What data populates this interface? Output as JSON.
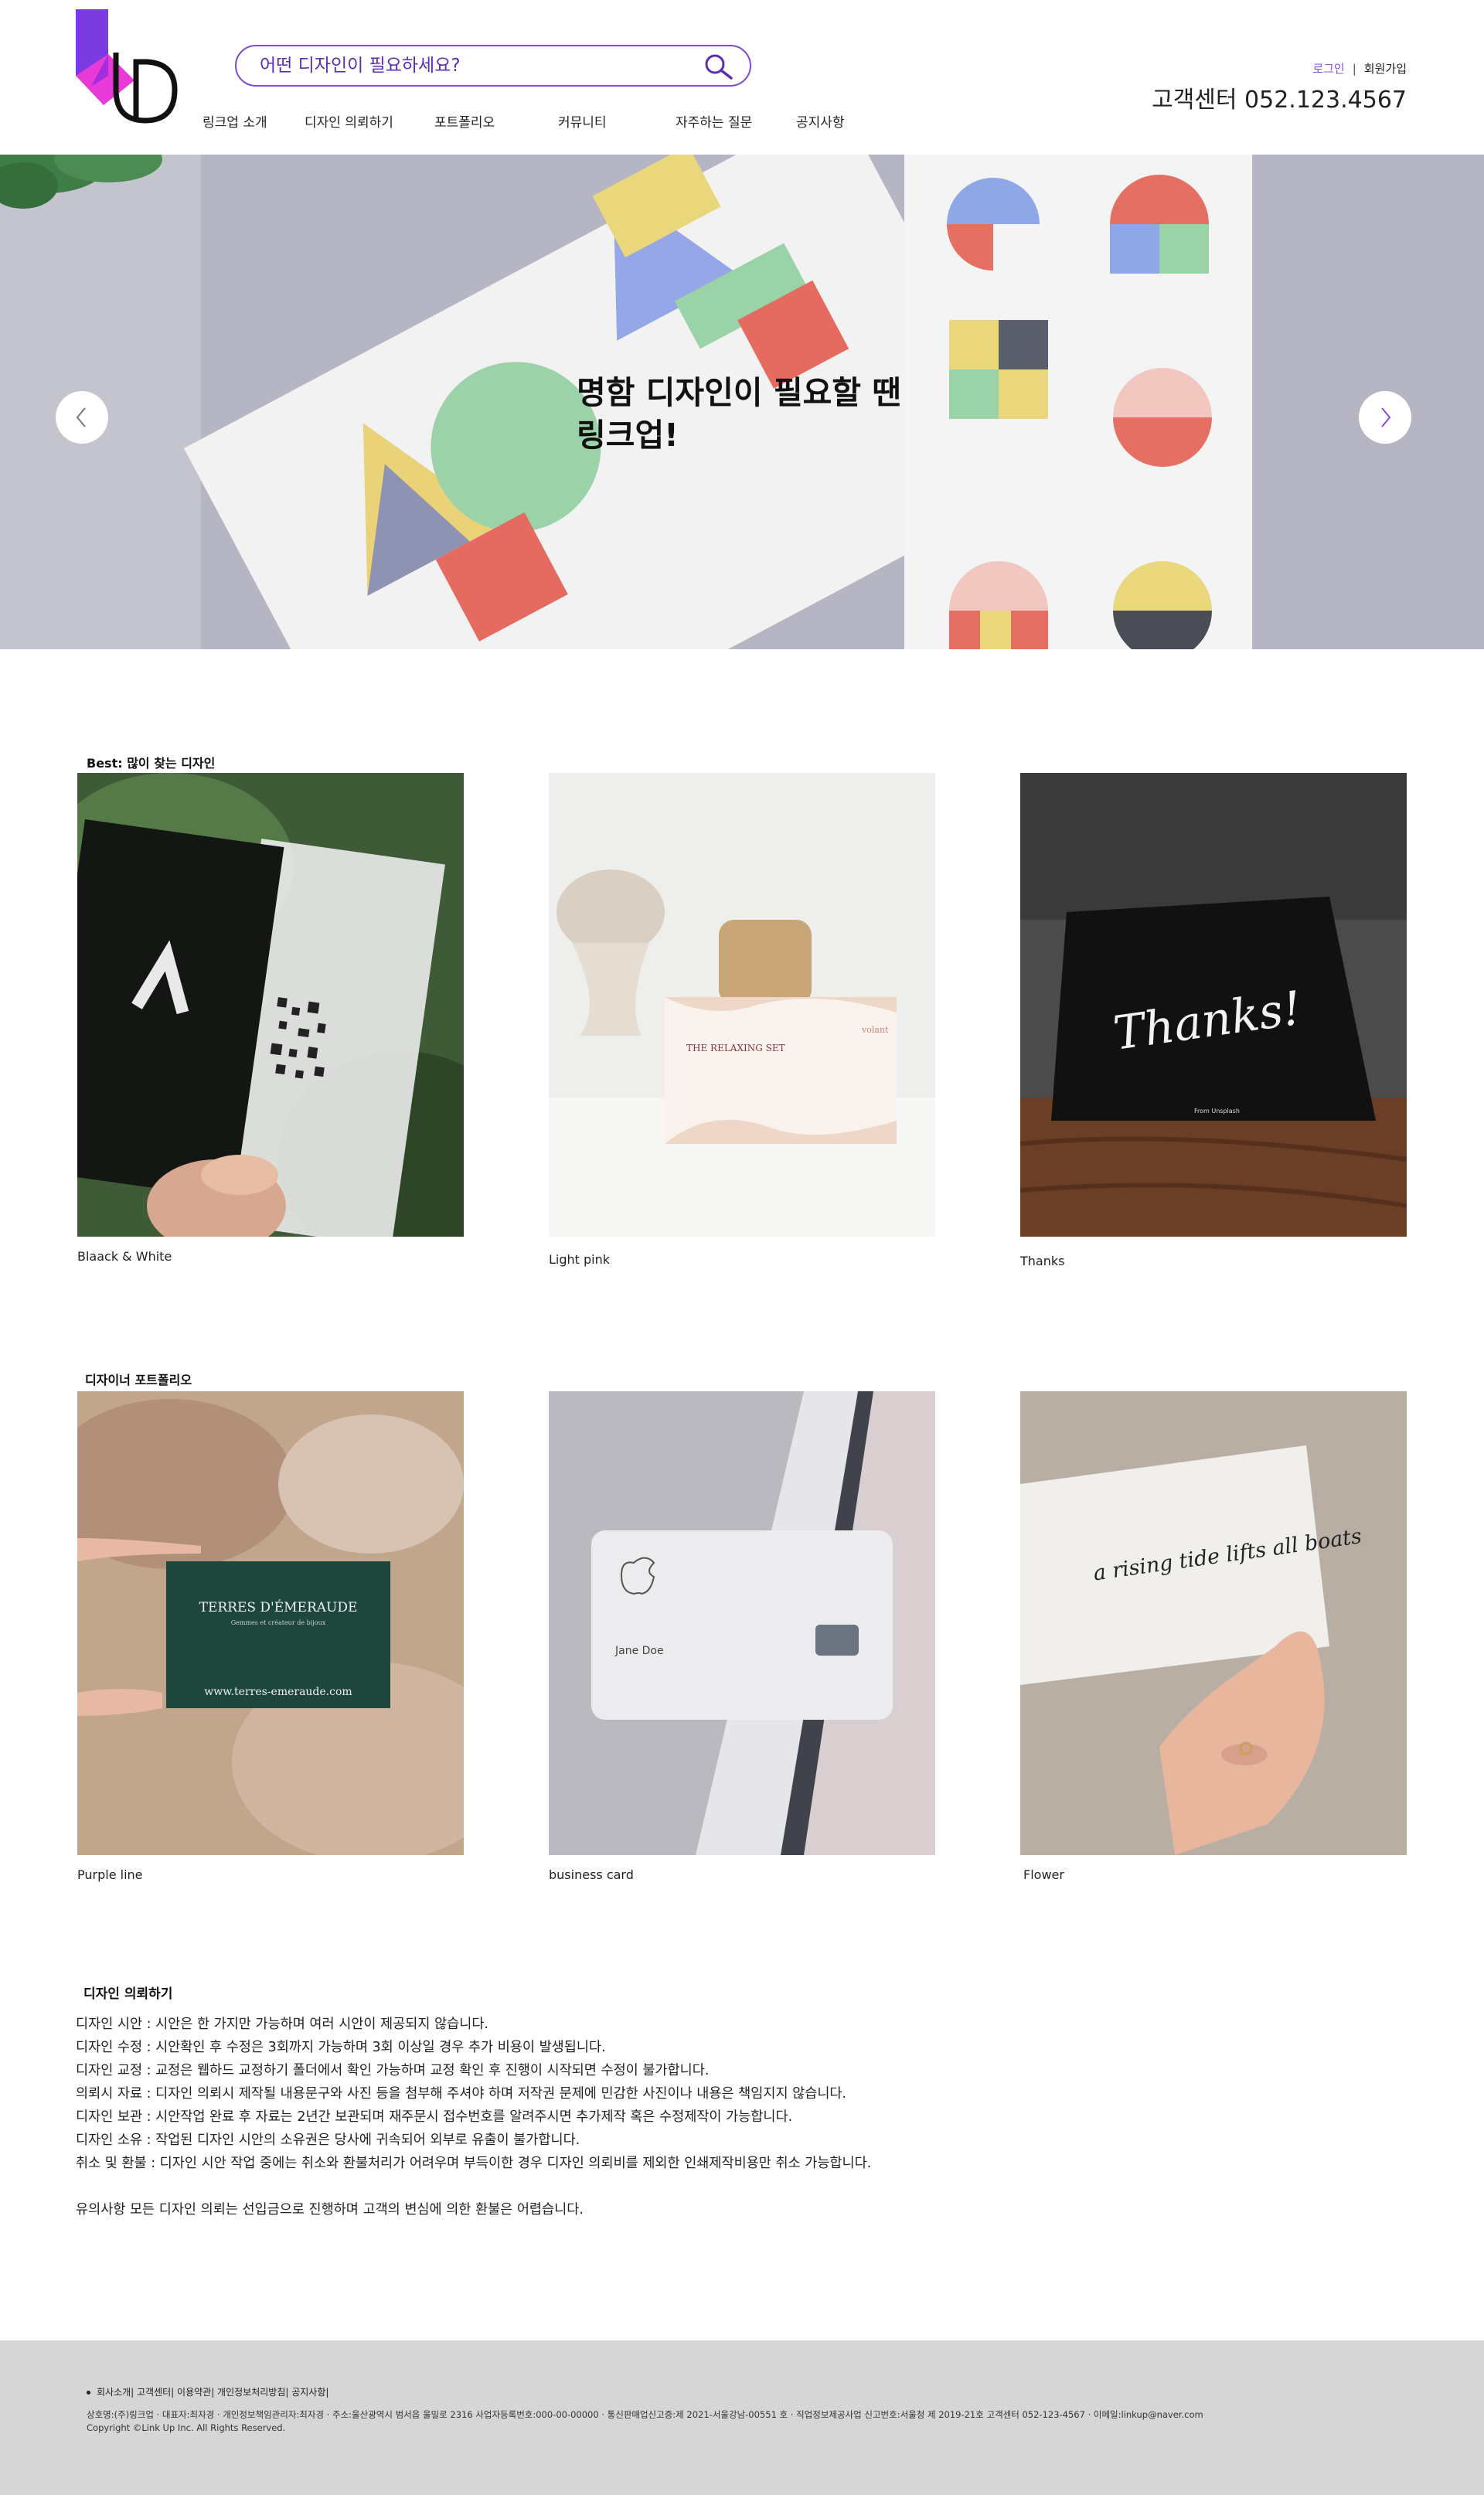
{
  "brand": {
    "logo_label": "Link Up logo",
    "colors": {
      "purple": "#7a3be0",
      "pink": "#e83ad6",
      "accent": "#7b4bd1",
      "footer_bg": "#d6d6d6"
    }
  },
  "search": {
    "placeholder": "어떤 디자인이 필요하세요?",
    "icon": "search-icon"
  },
  "nav": {
    "items": [
      {
        "label": "링크업 소개"
      },
      {
        "label": "디자인 의뢰하기"
      },
      {
        "label": "포트폴리오"
      },
      {
        "label": "커뮤니티"
      },
      {
        "label": "자주하는 질문"
      },
      {
        "label": "공지사항"
      }
    ]
  },
  "util": {
    "login": "로그인",
    "separator": "|",
    "join": "회원가입"
  },
  "customer_center": "고객센터 052.123.4567",
  "hero": {
    "line1": "명함 디자인이 필요할 땐",
    "line2": "링크업!",
    "prev_icon": "chevron-left-icon",
    "next_icon": "chevron-right-icon"
  },
  "best": {
    "title": "Best: 많이 찾는 디자인",
    "items": [
      {
        "caption": "Blaack & White"
      },
      {
        "caption": "Light pink",
        "card_text": "THE RELAXING SET",
        "brand": "volant"
      },
      {
        "caption": "Thanks",
        "card_text": "Thanks!",
        "small": "From Unsplash"
      }
    ]
  },
  "portfolio": {
    "title": "디자이너 포트폴리오",
    "items": [
      {
        "caption": "Purple line",
        "card_title": "TERRES D'ÉMERAUDE",
        "card_sub": "Gemmes et créateur de bijoux",
        "card_url": "www.terres-emeraude.com"
      },
      {
        "caption": "business card",
        "card_name": "Jane Doe"
      },
      {
        "caption": "Flower",
        "card_text": "a rising tide lifts all boats"
      }
    ]
  },
  "notice": {
    "title": "디자인 의뢰하기",
    "lines": [
      "디자인 시안 : 시안은 한 가지만 가능하며 여러 시안이 제공되지 않습니다.",
      "디자인 수정 : 시안확인 후 수정은 3회까지 가능하며 3회 이상일 경우 추가 비용이 발생됩니다.",
      "디자인 교정 : 교정은 웹하드 교정하기 폴더에서 확인 가능하며 교정 확인 후 진행이 시작되면 수정이 불가합니다.",
      "의뢰시 자료 : 디자인 의뢰시 제작될 내용문구와 사진 등을 첨부해 주셔야 하며 저작권 문제에 민감한 사진이나 내용은 책임지지 않습니다.",
      "디자인 보관 : 시안작업 완료 후 자료는 2년간 보관되며 재주문시 접수번호를 알려주시면 추가제작 혹은 수정제작이 가능합니다.",
      "디자인 소유 : 작업된 디자인 시안의 소유권은 당사에 귀속되어 외부로 유출이 불가합니다.",
      "취소 및 환불 : 디자인 시안 작업 중에는 취소와 환불처리가 어려우며 부득이한 경우 디자인 의뢰비를 제외한 인쇄제작비용만 취소 가능합니다."
    ],
    "warning": "유의사항 모든 디자인 의뢰는 선입금으로 진행하며 고객의 변심에 의한 환불은 어렵습니다."
  },
  "footer": {
    "links": "회사소개| 고객센터| 이용약관| 개인정보처리방침| 공지사항|",
    "info": "상호명:(주)링크업 · 대표자:최자경 · 개인정보책임관리자:최자경 · 주소:울산광역시 범서읍 울밀로 2316 사업자등록번호:000-00-00000 · 통신판매업신고증:제 2021-서울강남-00551 호 · 직업정보제공사업 신고번호:서울청 제 2019-21호 고객센터 052-123-4567 · 이메일:linkup@naver.com",
    "copyright": "Copyright ©Link Up Inc. All Rights Reserved."
  }
}
